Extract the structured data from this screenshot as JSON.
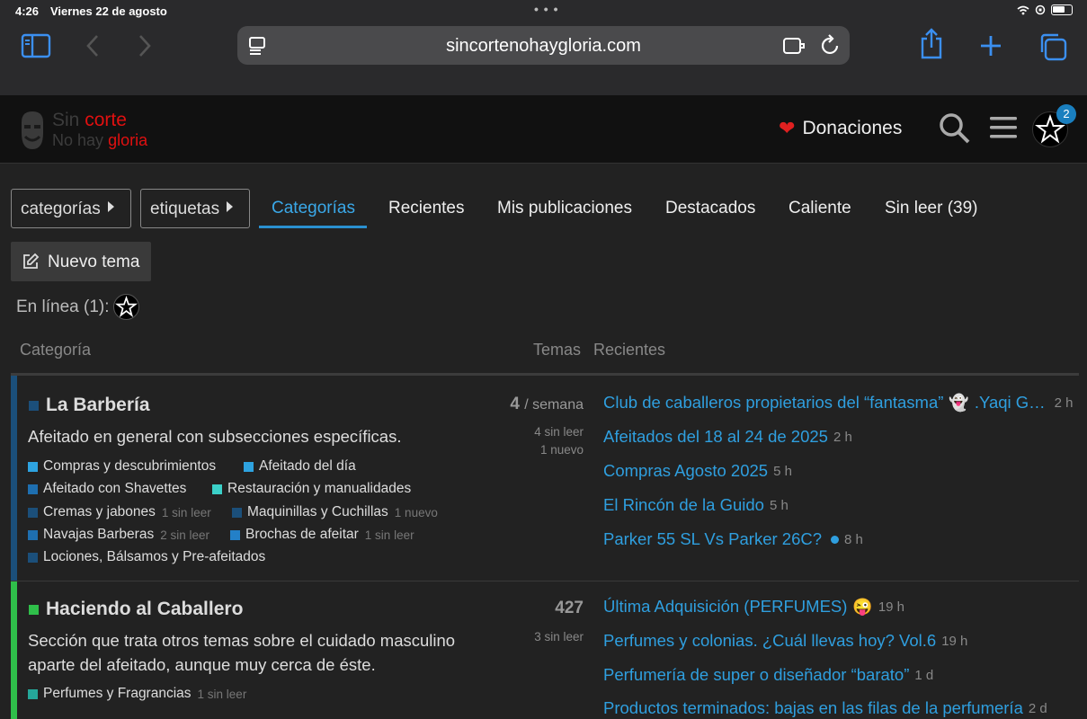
{
  "status_bar": {
    "time": "4:26",
    "date": "Viernes 22 de agosto"
  },
  "browser": {
    "url": "sincortenohaygloria.com"
  },
  "site": {
    "logo_line1_a": "Sin",
    "logo_line1_b": "corte",
    "logo_line2_a": "No hay",
    "logo_line2_b": "gloria",
    "donations_label": "Donaciones",
    "notification_count": "2"
  },
  "nav": {
    "dropdown_categories": "categorías",
    "dropdown_tags": "etiquetas",
    "tabs": [
      "Categorías",
      "Recientes",
      "Mis publicaciones",
      "Destacados",
      "Caliente",
      "Sin leer (39)"
    ],
    "active_tab": "Categorías",
    "new_topic": "Nuevo tema",
    "online_label": "En línea (1):"
  },
  "table": {
    "col_category": "Categoría",
    "col_topics": "Temas",
    "col_recent": "Recientes"
  },
  "categories": [
    {
      "name": "La Barbería",
      "color": "#1b4f7a",
      "description": "Afeitado en general con subsecciones específicas.",
      "topics_count": "4",
      "topics_unit": "/ semana",
      "unread": "4 sin leer",
      "new": "1 nuevo",
      "subcategories": [
        {
          "name": "Compras y descubrimientos",
          "color": "#2ea3e0",
          "meta": ""
        },
        {
          "name": "Afeitado del día",
          "color": "#2ea3e0",
          "meta": ""
        },
        {
          "name": "Afeitado con Shavettes",
          "color": "#1e6fb0",
          "meta": ""
        },
        {
          "name": "Restauración y manualidades",
          "color": "#3bd0c8",
          "meta": ""
        },
        {
          "name": "Cremas y jabones",
          "color": "#1b4f7a",
          "meta": "1 sin leer"
        },
        {
          "name": "Maquinillas y Cuchillas",
          "color": "#1b4f7a",
          "meta": "1 nuevo"
        },
        {
          "name": "Navajas Barberas",
          "color": "#1e6fb0",
          "meta": "2 sin leer"
        },
        {
          "name": "Brochas de afeitar",
          "color": "#2380c8",
          "meta": "1 sin leer"
        },
        {
          "name": "Lociones, Bálsamos y Pre-afeitados",
          "color": "#1b4f7a",
          "meta": ""
        }
      ],
      "recent": [
        {
          "title": "Club de caballeros propietarios del “fantasma”",
          "suffix": ".Yaqi G…",
          "age": "2 h",
          "emoji": "👻"
        },
        {
          "title": "Afeitados del 18 al 24 de 2025",
          "age": "2 h"
        },
        {
          "title": "Compras Agosto 2025",
          "age": "5 h"
        },
        {
          "title": "El Rincón de la Guido",
          "age": "5 h"
        },
        {
          "title": "Parker 55 SL Vs Parker 26C?",
          "age": "8 h",
          "unread_dot": true
        }
      ]
    },
    {
      "name": "Haciendo al Caballero",
      "color": "#2fbf4a",
      "description": "Sección que trata otros temas sobre el cuidado masculino aparte del afeitado, aunque muy cerca de éste.",
      "topics_count": "427",
      "unread": "3 sin leer",
      "subcategories": [
        {
          "name": "Perfumes y Fragrancias",
          "color": "#25a89a",
          "meta": "1 sin leer"
        }
      ],
      "recent": [
        {
          "title": "Última Adquisición (PERFUMES)",
          "age": "19 h",
          "emoji": "😜"
        },
        {
          "title": "Perfumes y colonias. ¿Cuál llevas hoy? Vol.6",
          "age": "19 h"
        },
        {
          "title": "Perfumería de super o diseñador “barato”",
          "age": "1 d"
        },
        {
          "title": "Productos terminados: bajas en las filas de la perfumería",
          "age": "2 d"
        }
      ]
    }
  ]
}
